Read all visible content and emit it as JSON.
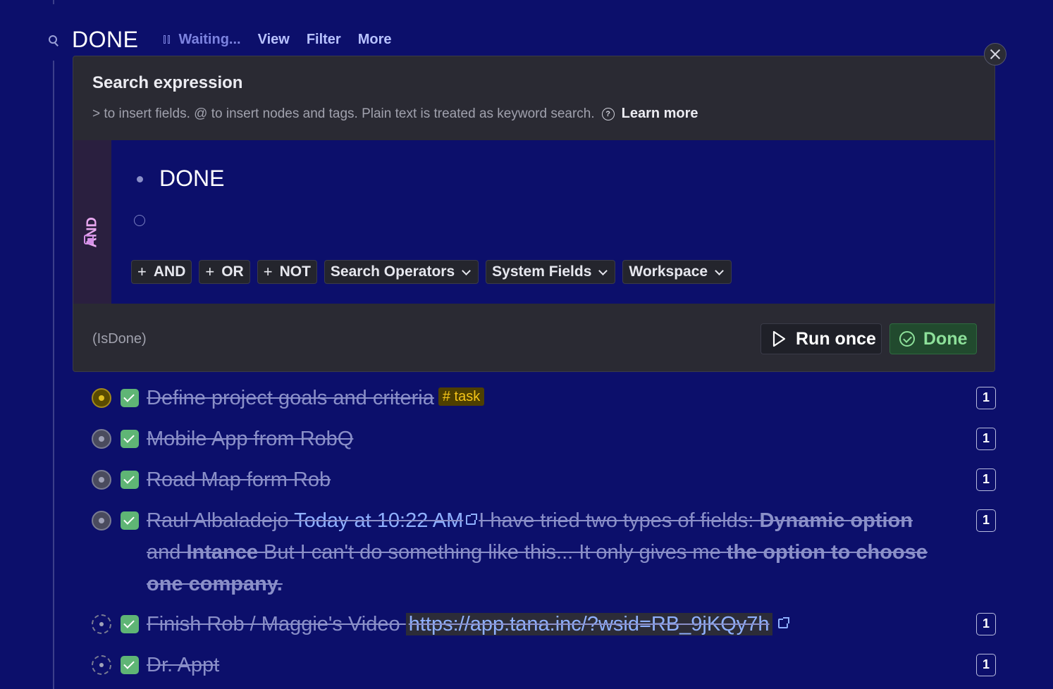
{
  "header": {
    "title": "DONE",
    "status": "Waiting...",
    "view_label": "View",
    "filter_label": "Filter",
    "more_label": "More"
  },
  "panel": {
    "title": "Search expression",
    "help_text": "> to insert fields. @ to insert nodes and tags. Plain text is treated as keyword search.",
    "learn_more": "Learn more",
    "group_operator": "AND",
    "term": "DONE",
    "operators": {
      "and": "AND",
      "or": "OR",
      "not": "NOT",
      "search_operators": "Search Operators",
      "system_fields": "System Fields",
      "workspace": "Workspace"
    },
    "query_preview": "(IsDone)",
    "run_once_label": "Run once",
    "done_label": "Done"
  },
  "results": [
    {
      "text": "Define project goals and criteria",
      "tag": "# task",
      "count": "1"
    },
    {
      "text": "Mobile App from RobQ",
      "count": "1"
    },
    {
      "text": "Road Map form Rob ",
      "count": "1"
    },
    {
      "author": "Raul Albaladejo ",
      "date": "Today at 10:22 AM",
      "p1": "I have tried two types of fields: ",
      "b1": "Dynamic option",
      "p2": " and ",
      "b2": "Intance",
      "p3": "  But I can't do something like this... It only gives me ",
      "b3": "the option to choose one company.",
      "count": "1"
    },
    {
      "text": "Finish Rob / Maggie's Video ",
      "url": "https://app.tana.inc/?wsid=RB_9jKQy7h",
      "count": "1"
    },
    {
      "text": "Dr. Appt ",
      "count": "1"
    }
  ],
  "colors": {
    "background": "#0c0f6b",
    "panel": "#2a2a33",
    "done_accent": "#8de09a",
    "checkbox": "#5fb575",
    "tag": "#f5c518"
  }
}
